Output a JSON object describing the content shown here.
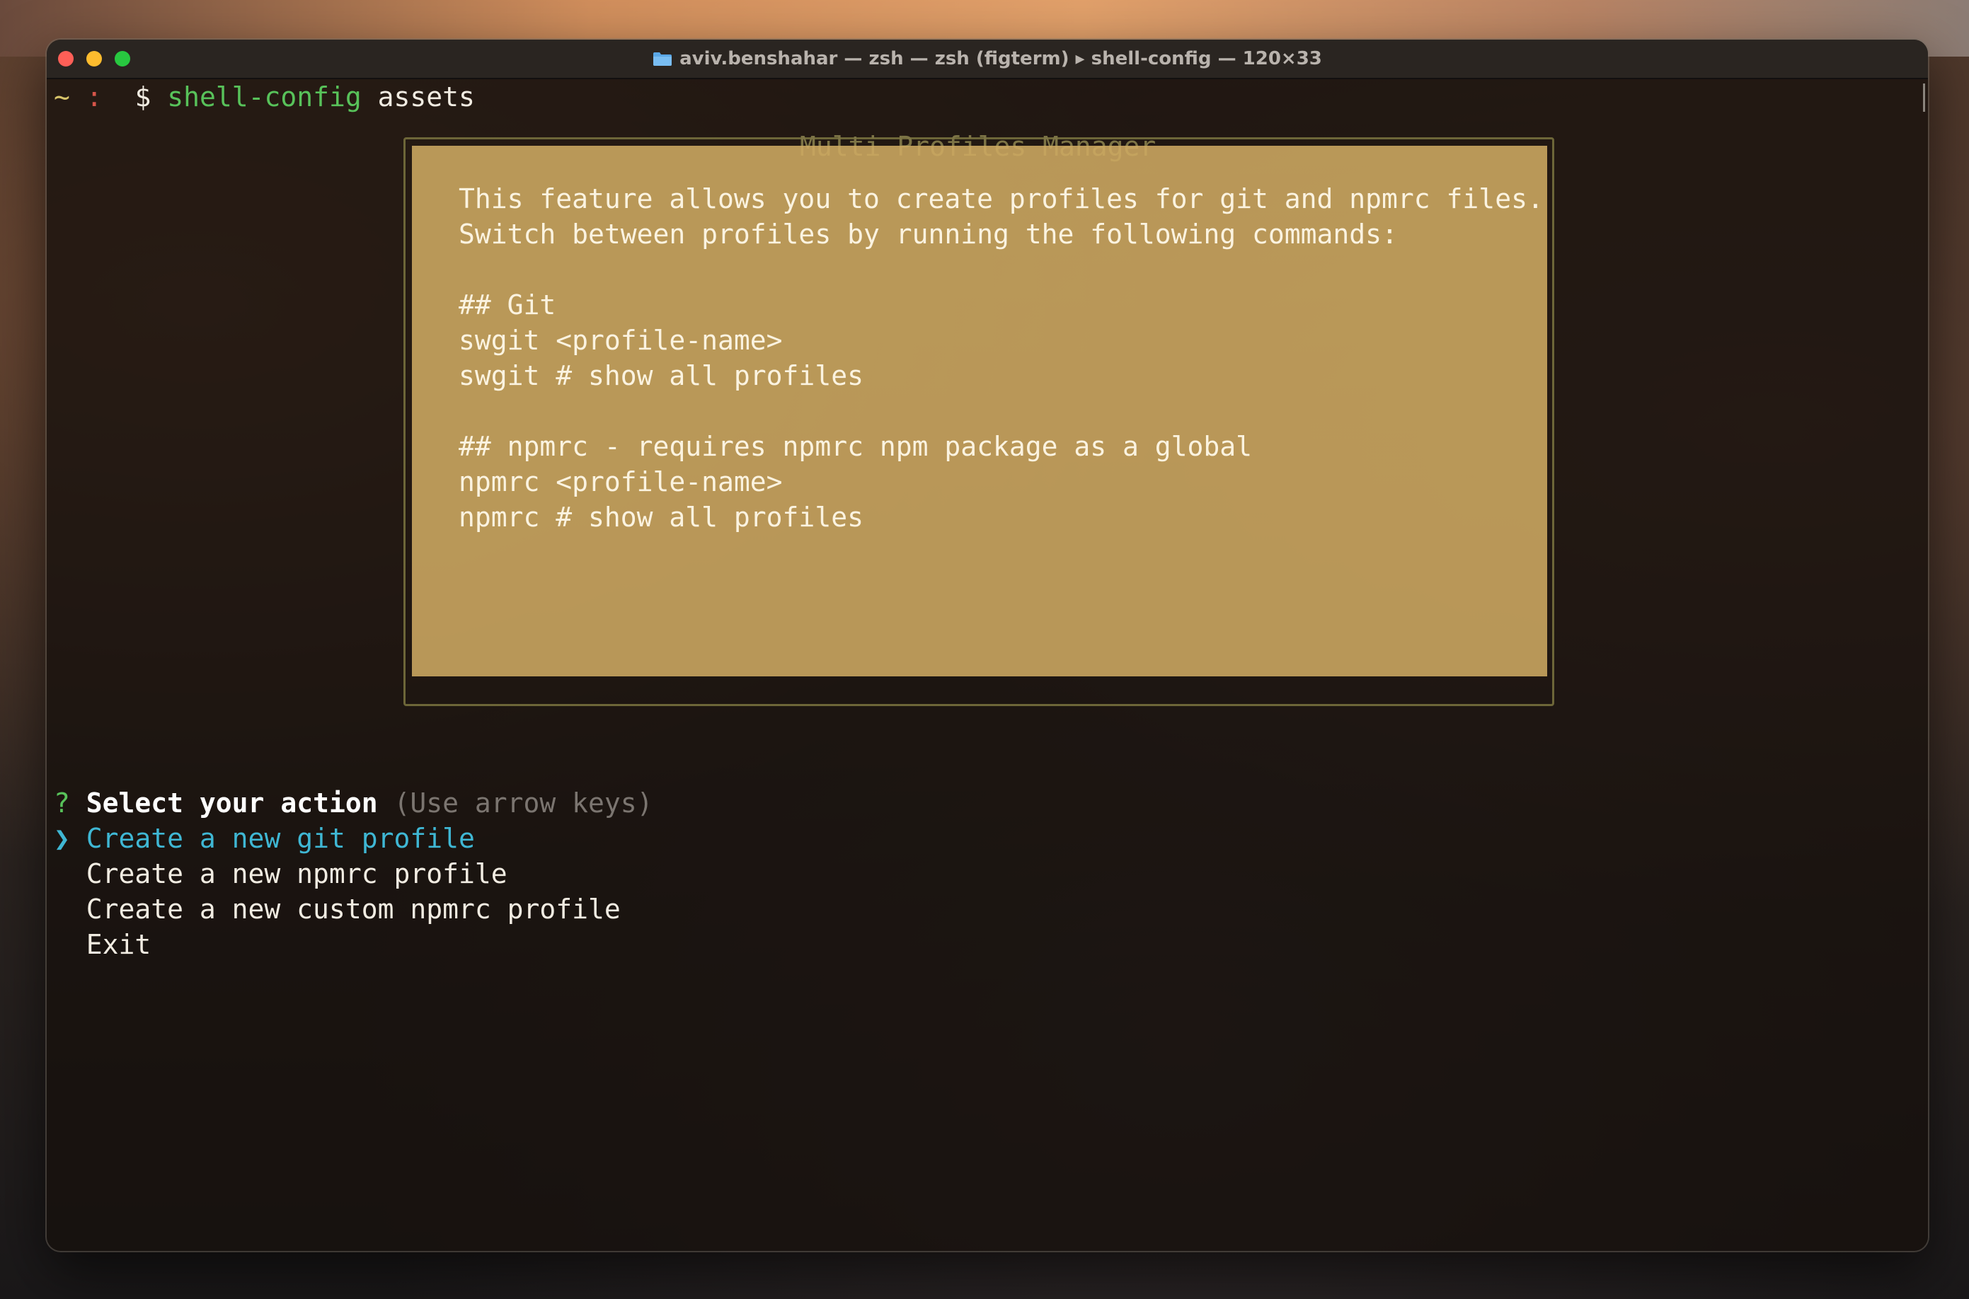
{
  "window": {
    "title": "aviv.benshahar — zsh — zsh (figterm) ▸ shell-config — 120×33",
    "folder_icon": "folder-icon"
  },
  "prompt": {
    "tilde": "~",
    "colon": ":",
    "dollar": "$",
    "command": "shell-config",
    "argument": "assets"
  },
  "box": {
    "title": "Multi Profiles Manager",
    "lines": [
      "This feature allows you to create profiles for git and npmrc files.",
      "Switch between profiles by running the following commands:",
      "## Git",
      "swgit <profile-name>",
      "swgit # show all profiles",
      "## npmrc - requires npmrc npm package as a global",
      "npmrc <profile-name>",
      "npmrc # show all profiles"
    ]
  },
  "menu": {
    "question_mark": "?",
    "question": "Select your action",
    "hint": "(Use arrow keys)",
    "pointer": "❯",
    "options": [
      "Create a new git profile",
      "Create a new npmrc profile",
      "Create a new custom npmrc profile",
      "Exit"
    ],
    "selected_index": 0
  },
  "colors": {
    "panel_background": "#ceaa62",
    "selected": "#3fb7d4",
    "command": "#58c25a"
  }
}
